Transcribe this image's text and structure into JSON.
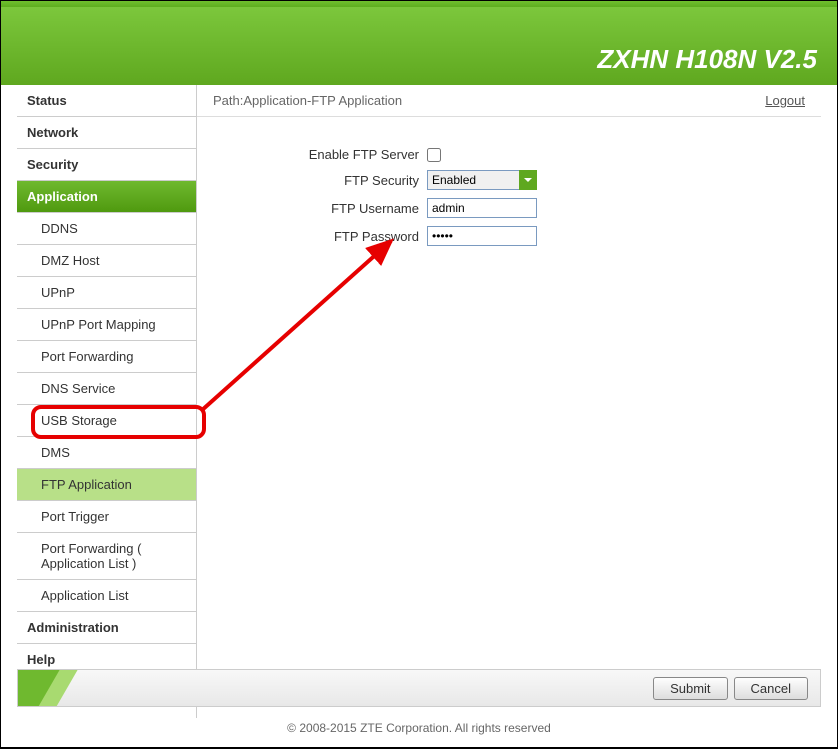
{
  "header": {
    "title": "ZXHN H108N V2.5"
  },
  "path": {
    "label": "Path:Application-FTP Application",
    "logout": "Logout"
  },
  "sidebar": {
    "categories": [
      {
        "label": "Status"
      },
      {
        "label": "Network"
      },
      {
        "label": "Security"
      },
      {
        "label": "Application",
        "active": true
      },
      {
        "label": "Administration"
      },
      {
        "label": "Help"
      }
    ],
    "app_subs": [
      {
        "label": "DDNS"
      },
      {
        "label": "DMZ Host"
      },
      {
        "label": "UPnP"
      },
      {
        "label": "UPnP Port Mapping"
      },
      {
        "label": "Port Forwarding"
      },
      {
        "label": "DNS Service"
      },
      {
        "label": "USB Storage"
      },
      {
        "label": "DMS"
      },
      {
        "label": "FTP Application",
        "highlighted": true
      },
      {
        "label": "Port Trigger"
      },
      {
        "label": "Port Forwarding ( Application List )"
      },
      {
        "label": "Application List"
      }
    ]
  },
  "form": {
    "enable_label": "Enable FTP Server",
    "security_label": "FTP Security",
    "security_value": "Enabled",
    "username_label": "FTP Username",
    "username_value": "admin",
    "password_label": "FTP Password",
    "password_value": "•••••"
  },
  "help_label": "Help",
  "buttons": {
    "submit": "Submit",
    "cancel": "Cancel"
  },
  "copyright": "© 2008-2015 ZTE Corporation. All rights reserved"
}
